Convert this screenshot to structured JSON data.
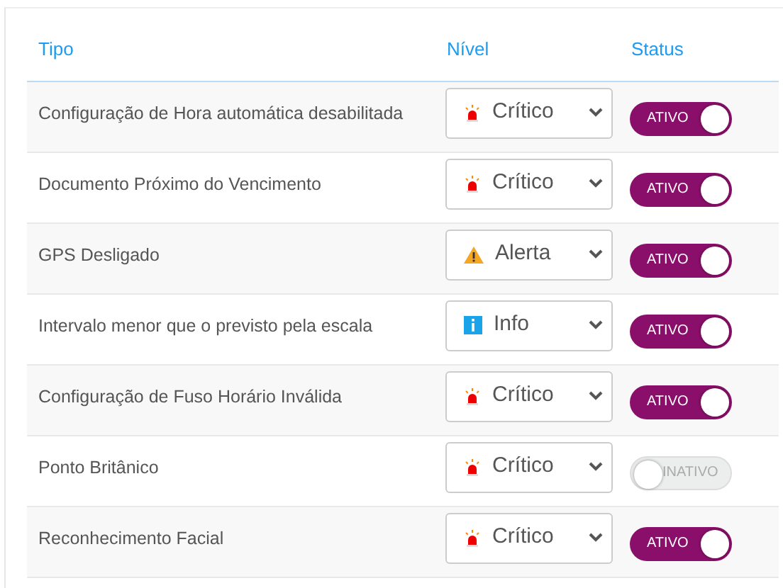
{
  "table": {
    "columns": [
      "Tipo",
      "Nível",
      "Status"
    ],
    "rows": [
      {
        "tipo": "Configuração de Hora automática desabilitada",
        "nivel": {
          "kind": "critico",
          "label": "Crítico"
        },
        "status": {
          "label": "ATIVO",
          "on": true
        }
      },
      {
        "tipo": "Documento Próximo do Vencimento",
        "nivel": {
          "kind": "critico",
          "label": "Crítico"
        },
        "status": {
          "label": "ATIVO",
          "on": true
        }
      },
      {
        "tipo": "GPS Desligado",
        "nivel": {
          "kind": "alerta",
          "label": "Alerta"
        },
        "status": {
          "label": "ATIVO",
          "on": true
        }
      },
      {
        "tipo": "Intervalo menor que o previsto pela escala",
        "nivel": {
          "kind": "info",
          "label": "Info"
        },
        "status": {
          "label": "ATIVO",
          "on": true
        }
      },
      {
        "tipo": "Configuração de Fuso Horário Inválida",
        "nivel": {
          "kind": "critico",
          "label": "Crítico"
        },
        "status": {
          "label": "ATIVO",
          "on": true
        }
      },
      {
        "tipo": "Ponto Britânico",
        "nivel": {
          "kind": "critico",
          "label": "Crítico"
        },
        "status": {
          "label": "INATIVO",
          "on": false
        }
      },
      {
        "tipo": "Reconhecimento Facial",
        "nivel": {
          "kind": "critico",
          "label": "Crítico"
        },
        "status": {
          "label": "ATIVO",
          "on": true
        }
      }
    ]
  }
}
